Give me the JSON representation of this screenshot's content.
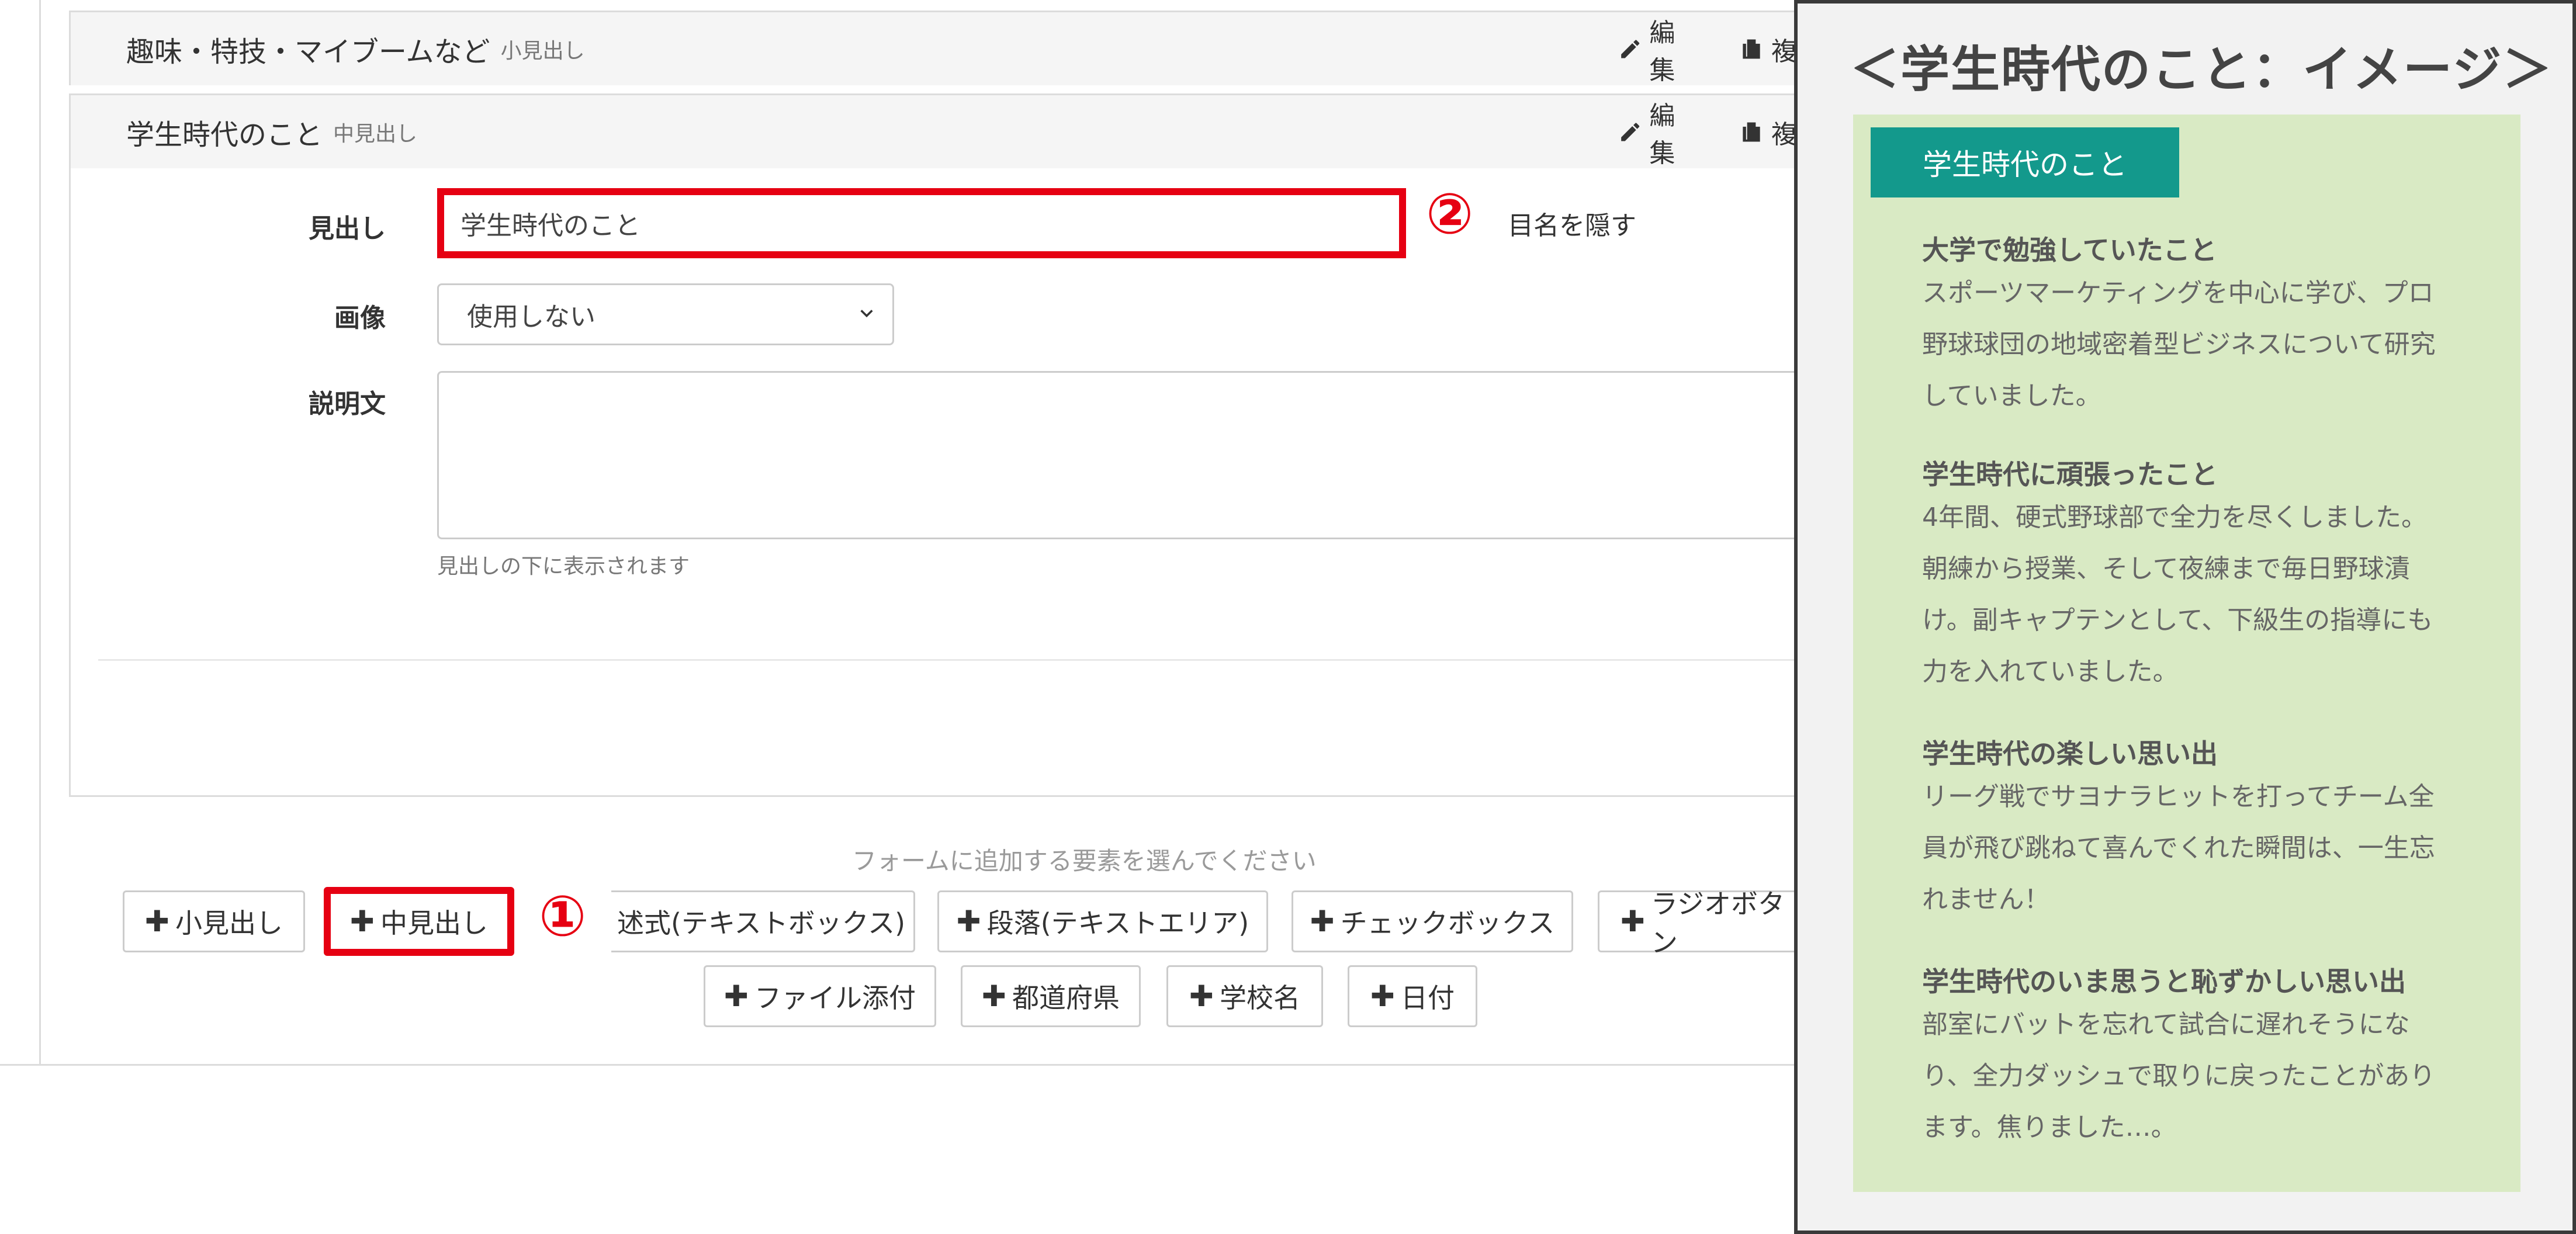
{
  "panels": [
    {
      "title": "趣味・特技・マイブームなど",
      "sub": "小見出し",
      "edit": "編集",
      "copy": "複"
    },
    {
      "title": "学生時代のこと",
      "sub": "中見出し",
      "edit": "編集",
      "copy": "複"
    }
  ],
  "form": {
    "heading_label": "見出し",
    "heading_value": "学生時代のこと",
    "hide_label": "目名を隠す",
    "image_label": "画像",
    "image_value": "使用しない",
    "desc_label": "説明文",
    "desc_help": "見出しの下に表示されます"
  },
  "callouts": {
    "one": "①",
    "two": "②"
  },
  "add": {
    "hint": "フォームに追加する要素を選んでください",
    "buttons": [
      "小見出し",
      "中見出し",
      "述式(テキストボックス)",
      "段落(テキストエリア)",
      "チェックボックス",
      "ラジオボタン",
      "ファイル添付",
      "都道府県",
      "学校名",
      "日付"
    ],
    "plus": "✚"
  },
  "preview": {
    "title": "＜学生時代のこと：イメージ＞",
    "tag": "学生時代のこと",
    "items": [
      {
        "h": "大学で勉強していたこと",
        "b": "スポーツマーケティングを中心に学び、プロ野球球団の地域密着型ビジネスについて研究していました。"
      },
      {
        "h": "学生時代に頑張ったこと",
        "b": "4年間、硬式野球部で全力を尽くしました。朝練から授業、そして夜練まで毎日野球漬け。副キャプテンとして、下級生の指導にも力を入れていました。"
      },
      {
        "h": "学生時代の楽しい思い出",
        "b": "リーグ戦でサヨナラヒットを打ってチーム全員が飛び跳ねて喜んでくれた瞬間は、一生忘れません！"
      },
      {
        "h": "学生時代のいま思うと恥ずかしい思い出",
        "b": "部室にバットを忘れて試合に遅れそうになり、全力ダッシュで取りに戻ったことがあります。焦りました…。"
      }
    ]
  },
  "colors": {
    "accent_red": "#e60012",
    "teal": "#13998c",
    "preview_bg": "#d9eac4"
  }
}
